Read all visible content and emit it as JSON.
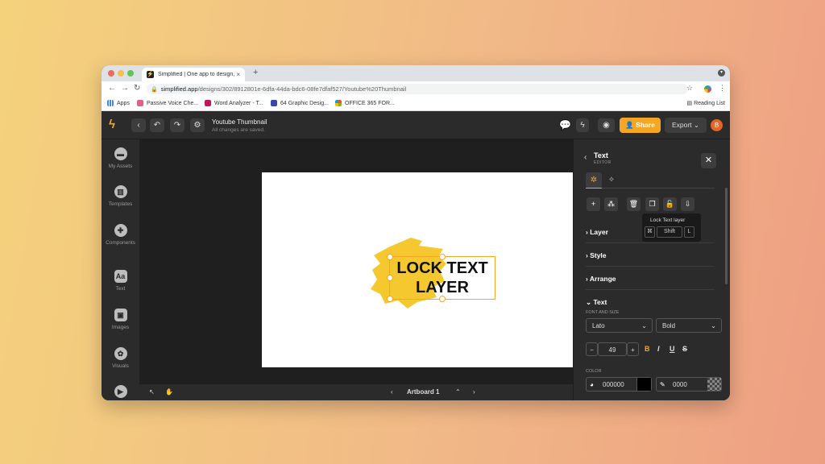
{
  "browser": {
    "tab_title": "Simplified | One app to design,",
    "tab_close": "×",
    "new_tab": "+",
    "url_host": "simplified.app",
    "url_path": "/designs/302/8912801e-6dfa-44da-bdc6-08fe7dfaf527/Youtube%20Thumbnail",
    "bookmarks": [
      "Apps",
      "Passive Voice Che...",
      "Word Analyzer - T...",
      "64 Graphic Desig...",
      "OFFICE 365 FOR..."
    ],
    "reading_list": "Reading List"
  },
  "app": {
    "doc_title": "Youtube Thumbnail",
    "doc_status": "All changes are saved.",
    "share_label": "Share",
    "export_label": "Export",
    "avatar_initial": "B"
  },
  "sidebar": {
    "items": [
      {
        "label": "My Assets",
        "icon": "folder-icon"
      },
      {
        "label": "Templates",
        "icon": "templates-icon"
      },
      {
        "label": "Components",
        "icon": "components-icon"
      },
      {
        "label": "Text",
        "icon": "text-icon",
        "glyph": "Aa"
      },
      {
        "label": "Images",
        "icon": "images-icon"
      },
      {
        "label": "Visuals",
        "icon": "visuals-icon"
      }
    ]
  },
  "canvas": {
    "text_line1": "LOCK TEXT",
    "text_line2": "LAYER",
    "artboard_label": "Artboard 1",
    "brush_color": "#f5c830"
  },
  "panel": {
    "title": "Text",
    "subtitle": "EDITOR",
    "tooltip_text": "Lock Text layer",
    "shortcut_keys": [
      "⌘",
      "Shift",
      "L"
    ],
    "sections": [
      "Layer",
      "Style",
      "Arrange",
      "Text"
    ],
    "font_size_label": "FONT AND SIZE",
    "font_family": "Lato",
    "font_weight": "Bold",
    "font_size": "49",
    "style_buttons": [
      "B",
      "I",
      "U",
      "S"
    ],
    "color_label": "COLOR",
    "color_hex": "000000",
    "stroke_value": "0000"
  },
  "colors": {
    "accent": "#f5a623",
    "app_bg": "#2b2b2b",
    "canvas_bg": "#1f1f1f"
  }
}
